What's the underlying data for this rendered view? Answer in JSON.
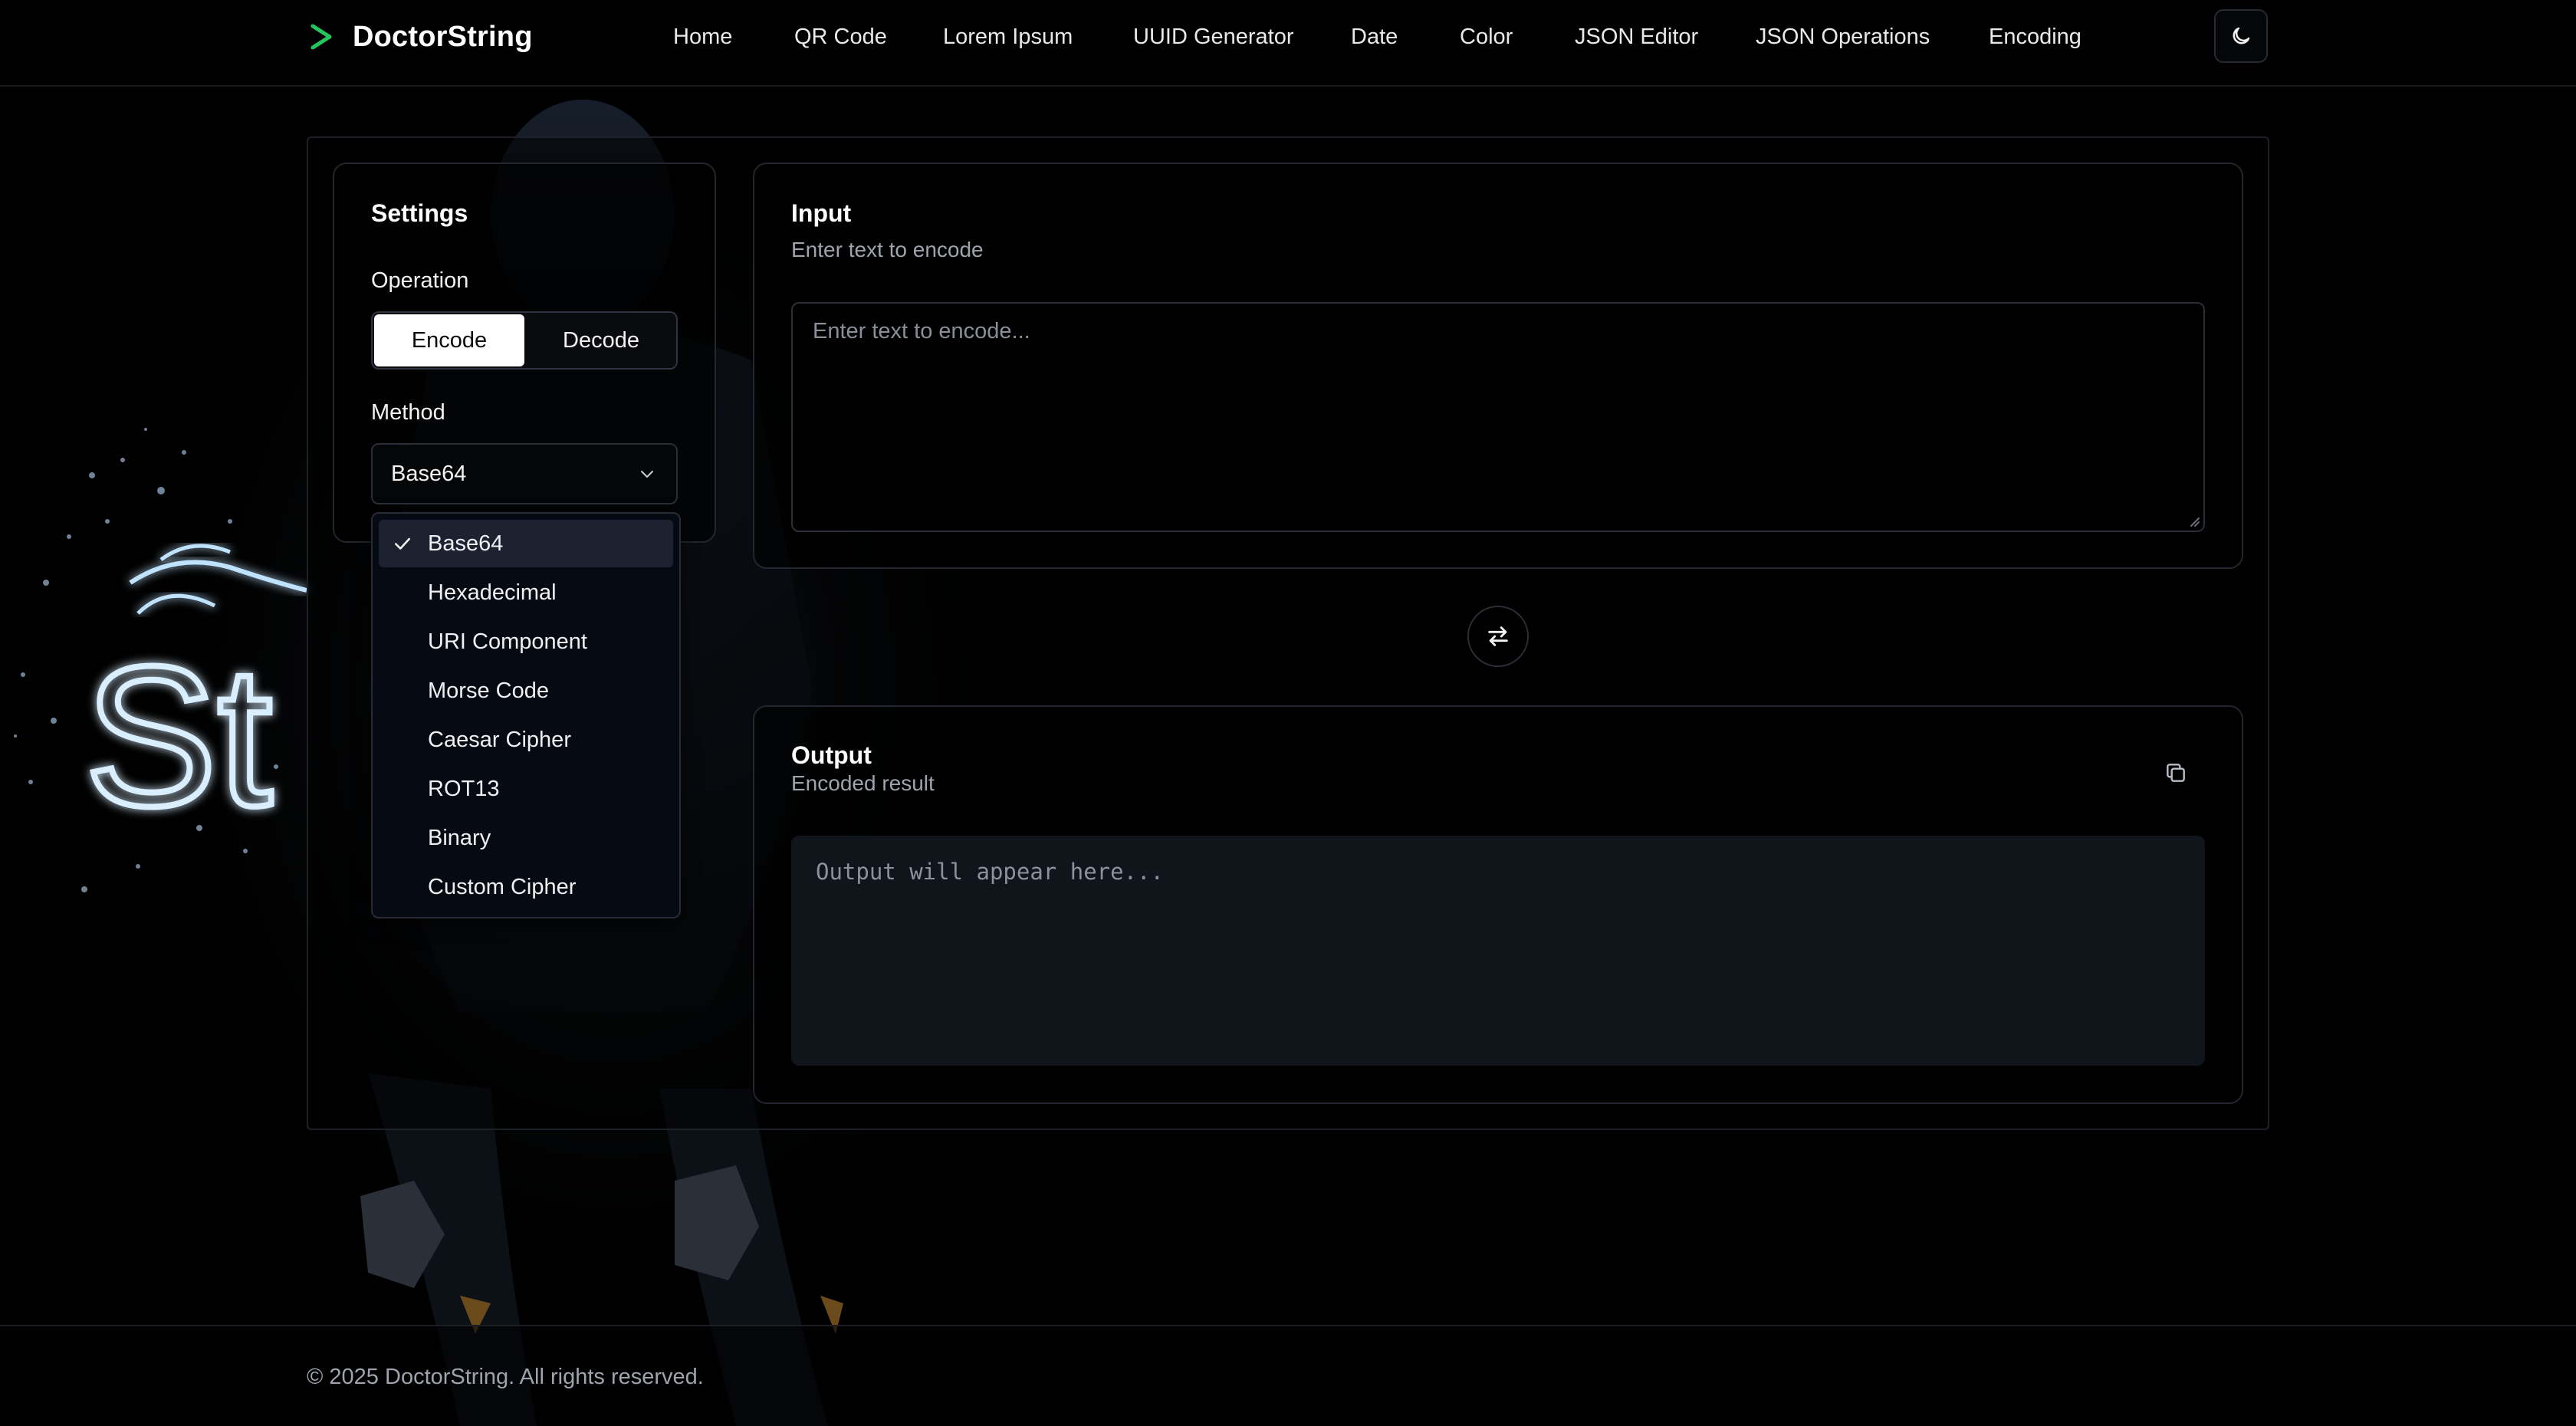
{
  "header": {
    "brand": "DoctorString",
    "nav": [
      {
        "label": "Home"
      },
      {
        "label": "QR Code"
      },
      {
        "label": "Lorem Ipsum"
      },
      {
        "label": "UUID Generator"
      },
      {
        "label": "Date"
      },
      {
        "label": "Color"
      },
      {
        "label": "JSON Editor"
      },
      {
        "label": "JSON Operations"
      },
      {
        "label": "Encoding"
      }
    ],
    "theme_toggle_icon": "moon-icon"
  },
  "settings": {
    "title": "Settings",
    "operation_label": "Operation",
    "operations": [
      "Encode",
      "Decode"
    ],
    "selected_operation": "Encode",
    "method_label": "Method",
    "selected_method": "Base64",
    "methods": [
      "Base64",
      "Hexadecimal",
      "URI Component",
      "Morse Code",
      "Caesar Cipher",
      "ROT13",
      "Binary",
      "Custom Cipher"
    ]
  },
  "input": {
    "title": "Input",
    "subtitle": "Enter text to encode",
    "placeholder": "Enter text to encode..."
  },
  "output": {
    "title": "Output",
    "subtitle": "Encoded result",
    "placeholder": "Output will appear here..."
  },
  "footer": {
    "text": "© 2025 DoctorString. All rights reserved."
  },
  "colors": {
    "accent": "#22c55e",
    "background": "#000000",
    "card_border": "#23262e",
    "dropdown_selected": "#1c2230"
  }
}
